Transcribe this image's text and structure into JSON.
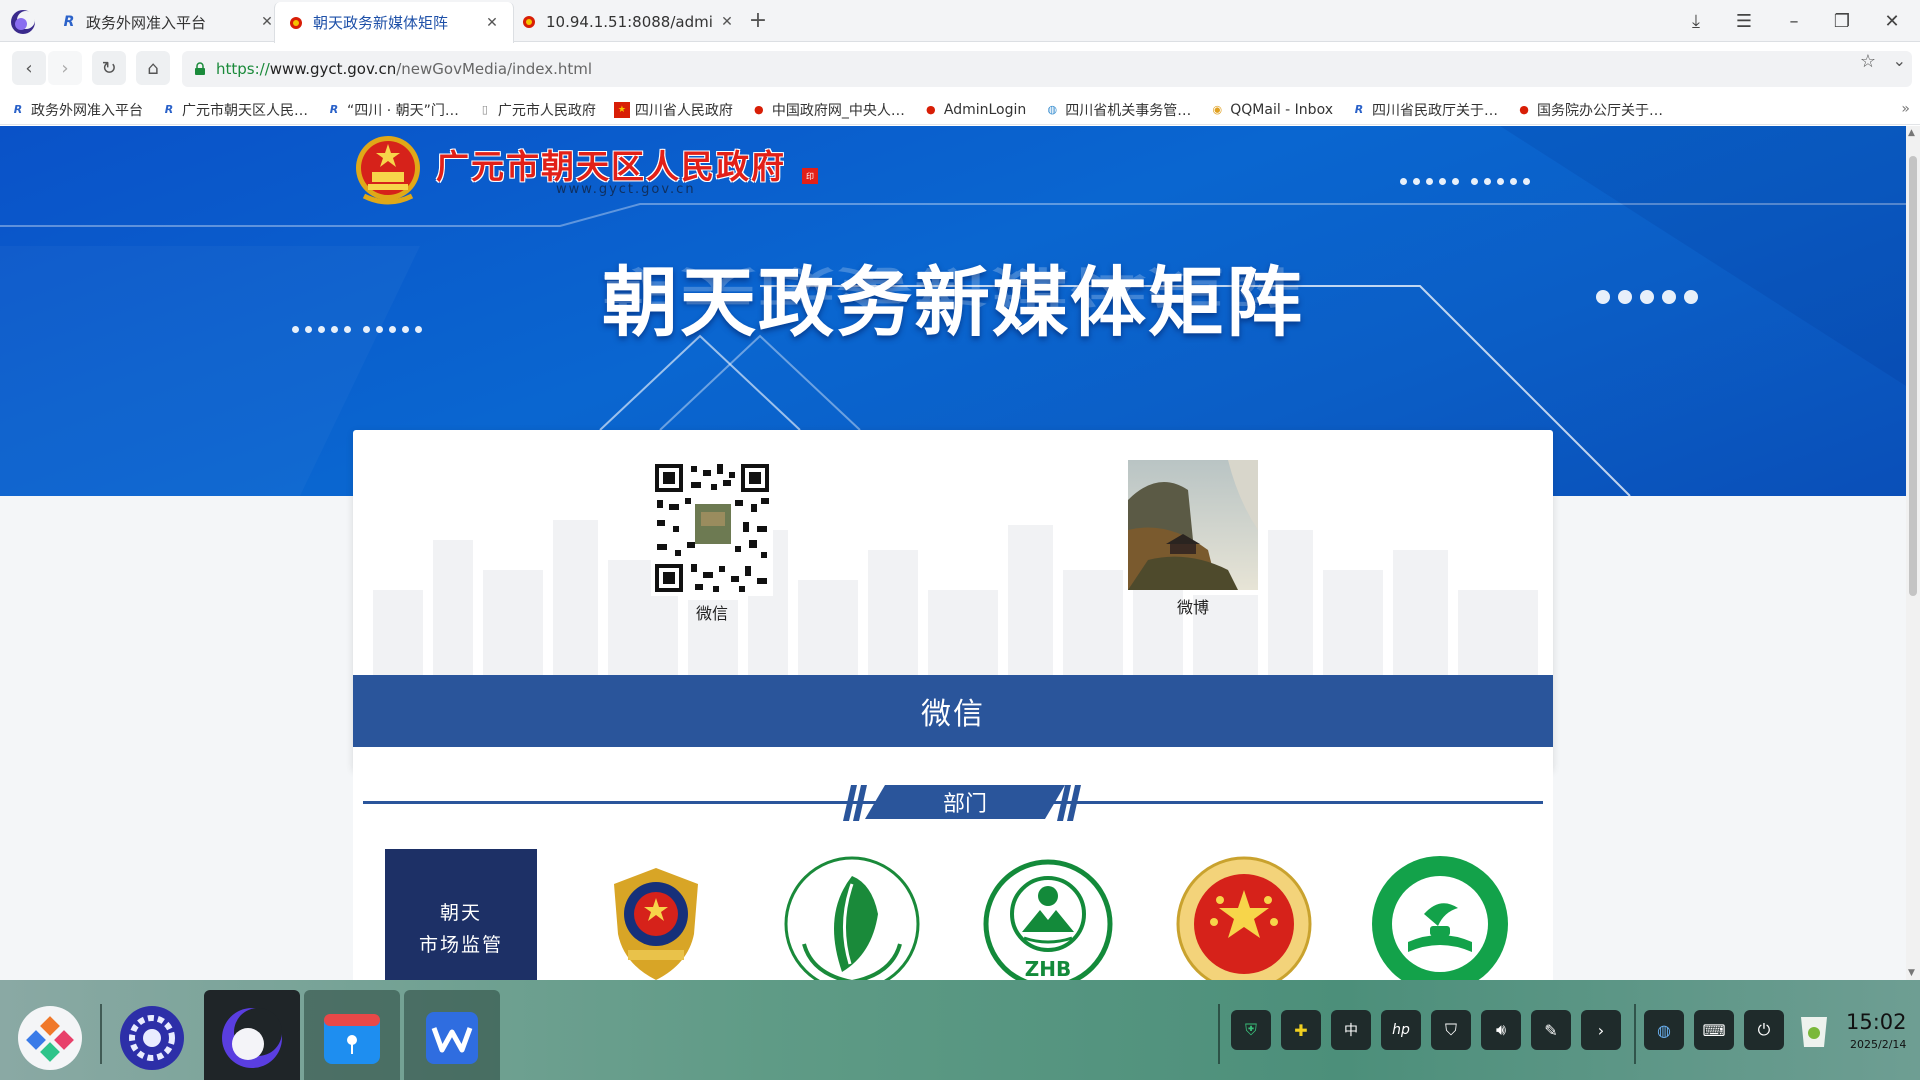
{
  "tabs": [
    {
      "title": "政务外网准入平台",
      "active": false
    },
    {
      "title": "朝天政务新媒体矩阵",
      "active": true
    },
    {
      "title": "10.94.1.51:8088/admi",
      "active": false
    }
  ],
  "address": {
    "scheme": "https://",
    "host": "www.gyct.gov.cn",
    "path": "/newGovMedia/index.html"
  },
  "bookmarks": [
    "政务外网准入平台",
    "广元市朝天区人民…",
    "“四川 · 朝天”门…",
    "广元市人民政府",
    "四川省人民政府",
    "中国政府网_中央人…",
    "AdminLogin",
    "四川省机关事务管…",
    "QQMail - Inbox",
    "四川省民政厅关于…",
    "国务院办公厅关于…"
  ],
  "page": {
    "gov_name": "广元市朝天区人民政府",
    "gov_domain": "www.gyct.gov.cn",
    "main_title": "朝天政务新媒体矩阵",
    "qr_items": [
      {
        "caption": "微信"
      },
      {
        "caption": "微博"
      }
    ],
    "section_title": "微信",
    "dept_label": "部门",
    "logos": [
      {
        "text_line1": "朝天",
        "text_line2": "市场监管"
      },
      {
        "name": "police"
      },
      {
        "name": "health"
      },
      {
        "name": "environment",
        "text": "ZHB"
      },
      {
        "name": "safety"
      },
      {
        "name": "education"
      }
    ]
  },
  "taskbar": {
    "time": "15:02",
    "date": "2025/2/14"
  },
  "colors": {
    "banner_blue": "#0a5fcc",
    "section_blue": "#2a559b",
    "gov_red": "#e22018"
  }
}
